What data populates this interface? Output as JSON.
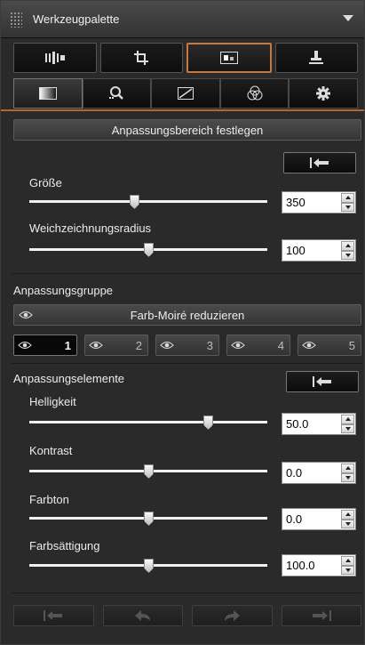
{
  "title": "Werkzeugpalette",
  "colors": {
    "accent": "#c8783a",
    "panel": "#2a2a2a"
  },
  "top_tabs": [
    {
      "icon": "curves-icon"
    },
    {
      "icon": "crop-icon"
    },
    {
      "icon": "adjustment-area-icon",
      "active": true
    },
    {
      "icon": "stamp-icon"
    }
  ],
  "second_tabs": [
    {
      "icon": "gradient-icon",
      "active": true
    },
    {
      "icon": "magnify-icon"
    },
    {
      "icon": "tone-curve-icon"
    },
    {
      "icon": "color-circles-icon"
    },
    {
      "icon": "gear-icon"
    }
  ],
  "set_area_button": "Anpassungsbereich festlegen",
  "size": {
    "label": "Größe",
    "value": "350",
    "level": 0.44
  },
  "blur": {
    "label": "Weichzeichnungsradius",
    "value": "100",
    "level": 0.5
  },
  "group": {
    "label": "Anpassungsgruppe",
    "bar_label": "Farb-Moiré reduzieren",
    "numbers": [
      "1",
      "2",
      "3",
      "4",
      "5"
    ],
    "active_index": 0
  },
  "elements": {
    "label": "Anpassungselemente",
    "items": [
      {
        "label": "Helligkeit",
        "value": "50.0",
        "level": 0.75
      },
      {
        "label": "Kontrast",
        "value": "0.0",
        "level": 0.5
      },
      {
        "label": "Farbton",
        "value": "0.0",
        "level": 0.5
      },
      {
        "label": "Farbsättigung",
        "value": "100.0",
        "level": 0.5
      }
    ]
  },
  "bottom_buttons": [
    "first-step-icon",
    "undo-icon",
    "redo-icon",
    "last-step-icon"
  ]
}
